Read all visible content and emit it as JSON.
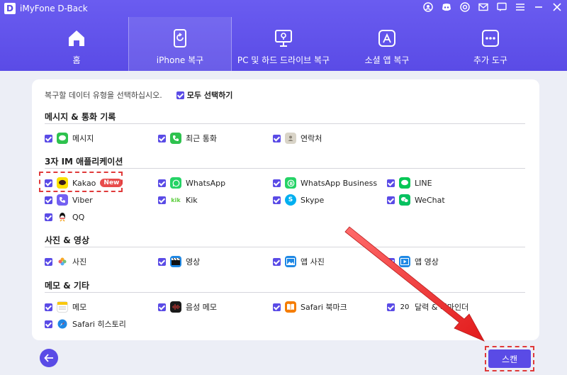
{
  "app": {
    "title": "iMyFone D-Back",
    "logo_letter": "D"
  },
  "tabs": [
    {
      "label": "홈",
      "icon": "home-icon"
    },
    {
      "label": "iPhone 복구",
      "icon": "phone-restore-icon",
      "active": true
    },
    {
      "label": "PC 및 하드 드라이브 복구",
      "icon": "pc-drive-icon"
    },
    {
      "label": "소셜 앱 복구",
      "icon": "app-store-icon"
    },
    {
      "label": "추가 도구",
      "icon": "more-tools-icon"
    }
  ],
  "content": {
    "prompt": "복구할 데이터 유형을 선택하십시오.",
    "select_all": "모두 선택하기",
    "sections": [
      {
        "title": "메시지 & 통화 기록",
        "items": [
          "메시지",
          "최근 통화",
          "연락처"
        ]
      },
      {
        "title": "3자 IM 애플리케이션",
        "items": [
          "Kakao",
          "WhatsApp",
          "WhatsApp Business",
          "LINE",
          "Viber",
          "Kik",
          "Skype",
          "WeChat",
          "QQ"
        ]
      },
      {
        "title": "사진 & 영상",
        "items": [
          "사진",
          "영상",
          "앱 사진",
          "앱 영상"
        ]
      },
      {
        "title": "메모 & 기타",
        "items": [
          "메모",
          "음성 메모",
          "Safari 북마크",
          "달력 & 리마인더",
          "Safari 히스토리"
        ]
      }
    ],
    "new_badge": "New"
  },
  "footer": {
    "scan_label": "스캔",
    "back_icon": "arrow-left-icon"
  },
  "colors": {
    "accent": "#5a4be6",
    "highlight": "#e03a3a"
  }
}
